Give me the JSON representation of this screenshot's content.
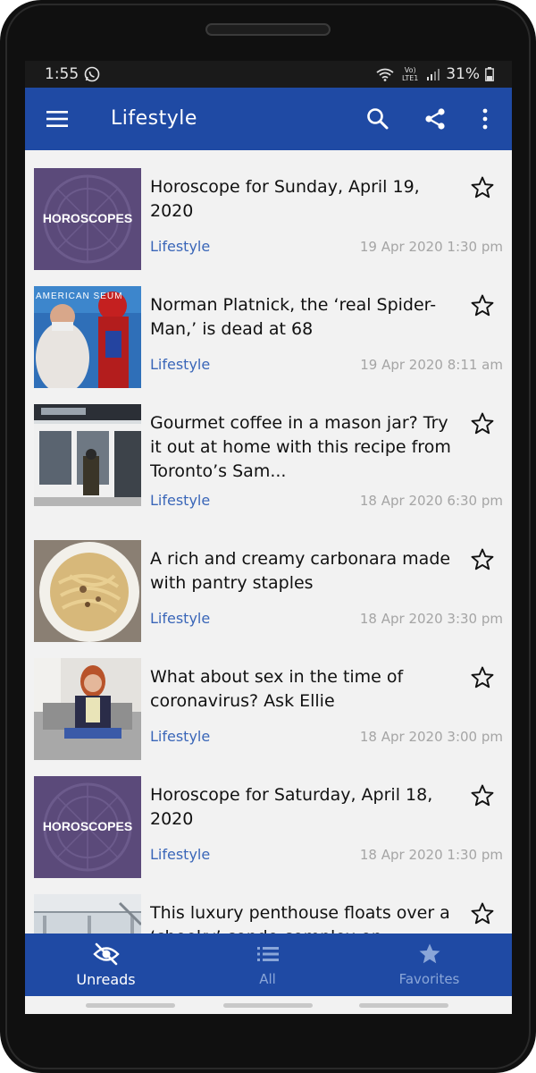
{
  "status_bar": {
    "time": "1:55",
    "network": "Vo) LTE1",
    "battery": "31%"
  },
  "app_bar": {
    "title": "Lifestyle"
  },
  "articles": [
    {
      "headline": "Horoscope for Sunday, April 19, 2020",
      "category": "Lifestyle",
      "timestamp": "19 Apr 2020 1:30 pm",
      "thumb_text": "HOROSCOPES"
    },
    {
      "headline": "Norman Platnick, the ‘real Spider-Man,’ is dead at 68",
      "category": "Lifestyle",
      "timestamp": "19 Apr 2020 8:11 am",
      "thumb_text": "AMERICAN  SEUM"
    },
    {
      "headline": "Gourmet coffee in a mason jar? Try it out at home with this recipe from Toronto’s Sam...",
      "category": "Lifestyle",
      "timestamp": "18 Apr 2020 6:30 pm",
      "thumb_text": ""
    },
    {
      "headline": "A rich and creamy carbonara made with pantry staples",
      "category": "Lifestyle",
      "timestamp": "18 Apr 2020 3:30 pm",
      "thumb_text": ""
    },
    {
      "headline": "What about sex in the time of coronavirus? Ask Ellie",
      "category": "Lifestyle",
      "timestamp": "18 Apr 2020 3:00 pm",
      "thumb_text": ""
    },
    {
      "headline": "Horoscope for Saturday, April 18, 2020",
      "category": "Lifestyle",
      "timestamp": "18 Apr 2020 1:30 pm",
      "thumb_text": "HOROSCOPES"
    },
    {
      "headline": "This luxury penthouse floats over a ‘cheeky’ condo complex on Toronto’s waterfront",
      "category": "",
      "timestamp": "",
      "thumb_text": ""
    }
  ],
  "bottom_nav": {
    "unreads": {
      "label": "Unreads",
      "icon": "eye-off-icon"
    },
    "all": {
      "label": "All",
      "icon": "list-icon"
    },
    "favorites": {
      "label": "Favorites",
      "icon": "star-icon"
    }
  },
  "colors": {
    "primary": "#1f4aa4",
    "category": "#3a66b8",
    "timestamp": "#a5a5a5"
  }
}
